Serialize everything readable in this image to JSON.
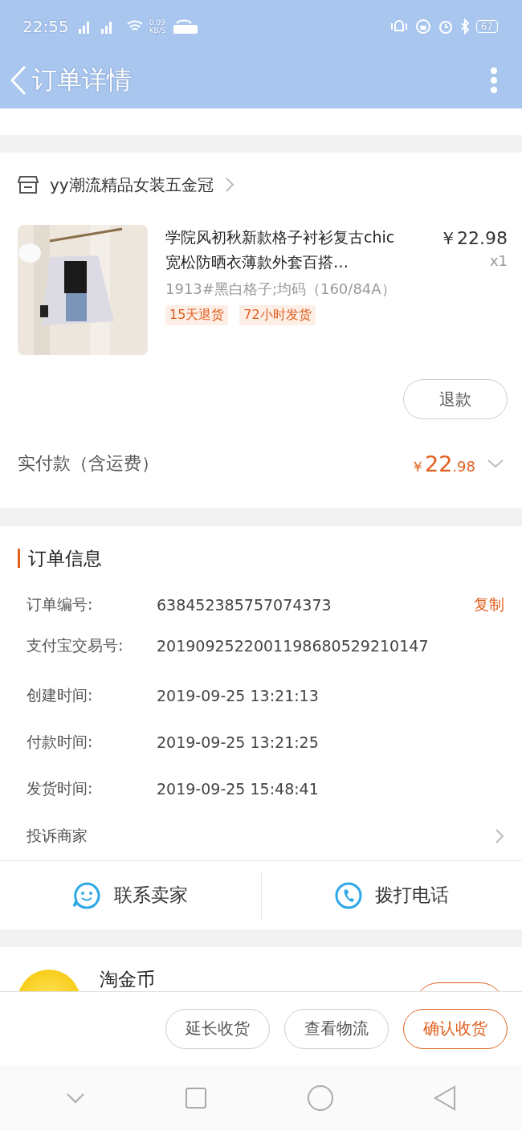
{
  "status_bar": {
    "time": "22:55",
    "net_speed": "0.09",
    "net_unit": "KB/S",
    "battery": "67"
  },
  "header": {
    "title": "订单详情"
  },
  "shop": {
    "name": "yy潮流精品女装五金冠"
  },
  "product": {
    "title": "学院风初秋新款格子衬衫复古chic宽松防晒衣薄款外套百搭…",
    "spec": "1913#黑白格子;均码（160/84A）",
    "tags": [
      "15天退货",
      "72小时发货"
    ],
    "price": "￥22.98",
    "quantity": "x1",
    "refund_button": "退款"
  },
  "payment": {
    "label": "实付款（含运费）",
    "currency": "￥",
    "amount_main": "22",
    "amount_decimal": ".98"
  },
  "order_info": {
    "title": "订单信息",
    "rows": [
      {
        "label": "订单编号:",
        "value": "638452385757074373",
        "action": "复制"
      },
      {
        "label": "支付宝交易号:",
        "value": "2019092522001198680529210147"
      },
      {
        "label": "创建时间:",
        "value": "2019-09-25 13:21:13"
      },
      {
        "label": "付款时间:",
        "value": "2019-09-25 13:21:25"
      },
      {
        "label": "发货时间:",
        "value": "2019-09-25 15:48:41"
      }
    ],
    "complaint": "投诉商家"
  },
  "contact": [
    {
      "kind": "chat",
      "label": "联系卖家"
    },
    {
      "kind": "phone",
      "label": "拨打电话"
    }
  ],
  "coins": {
    "title": "淘金币"
  },
  "actions": [
    {
      "label": "延长收货",
      "primary": false
    },
    {
      "label": "查看物流",
      "primary": false
    },
    {
      "label": "确认收货",
      "primary": true
    }
  ]
}
